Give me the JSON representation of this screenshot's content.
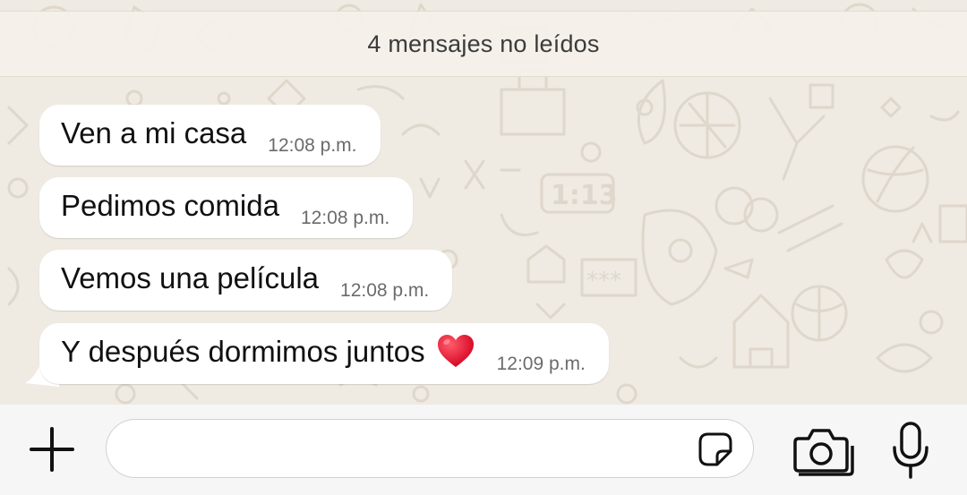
{
  "banner": {
    "unread_text": "4 mensajes no leídos"
  },
  "messages": [
    {
      "text": "Ven a mi casa",
      "time": "12:08 p.m."
    },
    {
      "text": "Pedimos comida",
      "time": "12:08 p.m."
    },
    {
      "text": "Vemos una película",
      "time": "12:08 p.m."
    },
    {
      "text": "Y después dormimos juntos",
      "emoji": "red-heart",
      "time": "12:09 p.m."
    }
  ],
  "composer": {
    "input_value": "",
    "icons": [
      "plus-icon",
      "sticker-icon",
      "camera-icon",
      "microphone-icon"
    ]
  },
  "colors": {
    "chat_background": "#efeae2",
    "bubble": "#ffffff",
    "heart": "#e3102b"
  }
}
